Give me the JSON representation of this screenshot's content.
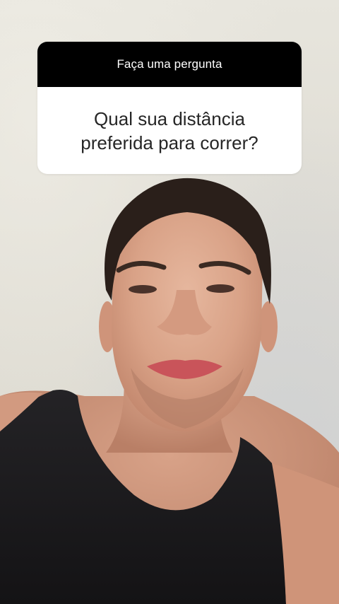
{
  "question_sticker": {
    "header": "Faça uma pergunta",
    "question": "Qual sua distância preferida para correr?"
  },
  "colors": {
    "sticker_header_bg": "#000000",
    "sticker_body_bg": "#ffffff",
    "sticker_text": "#262626",
    "wall": "#e2e0d8",
    "tank_top": "#1c1b1d",
    "skin": "#d9a58b"
  },
  "scene": {
    "subject": "person-selfie-camera-view"
  }
}
